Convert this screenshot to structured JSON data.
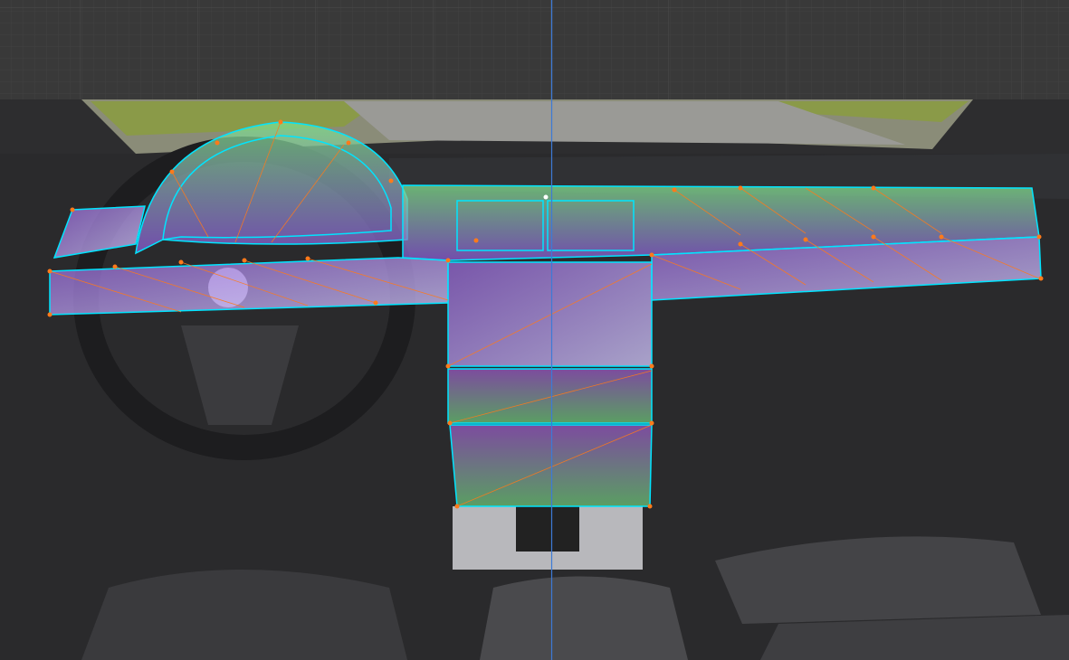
{
  "viewport": {
    "background_color": "#393939",
    "axis_line_color": "#3d7ad6",
    "mesh_edge_color": "#00e5ff",
    "mesh_vertex_color": "#ff7a1a",
    "mesh_face_gradient": [
      "#6fe07a",
      "#8a5ad8"
    ],
    "icons": [
      "reference-image",
      "mesh-overlay"
    ]
  }
}
